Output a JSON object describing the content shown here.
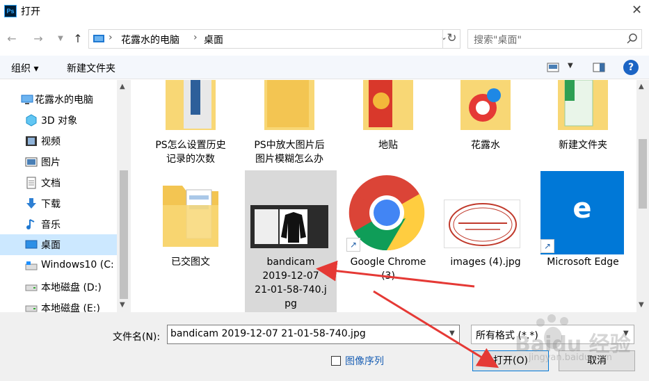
{
  "window": {
    "title": "打开",
    "app_icon": "Ps"
  },
  "address": {
    "crumbs": [
      "花露水的电脑",
      "桌面"
    ],
    "search_placeholder": "搜索\"桌面\""
  },
  "toolbar": {
    "organize": "组织 ▾",
    "new_folder": "新建文件夹",
    "help": "?"
  },
  "nav": {
    "items": [
      {
        "label": "花露水的电脑",
        "icon": "computer-icon"
      },
      {
        "label": "3D 对象",
        "icon": "cube-icon"
      },
      {
        "label": "视频",
        "icon": "video-icon"
      },
      {
        "label": "图片",
        "icon": "picture-icon"
      },
      {
        "label": "文档",
        "icon": "document-icon"
      },
      {
        "label": "下载",
        "icon": "download-icon"
      },
      {
        "label": "音乐",
        "icon": "music-icon"
      },
      {
        "label": "桌面",
        "icon": "desktop-icon"
      },
      {
        "label": "Windows10 (C:",
        "icon": "drive-icon"
      },
      {
        "label": "本地磁盘 (D:)",
        "icon": "drive-icon"
      },
      {
        "label": "本地磁盘 (E:)",
        "icon": "drive-icon"
      }
    ]
  },
  "files": {
    "row1": [
      "PS怎么设置历史\n记录的次数",
      "PS中放大图片后\n图片模糊怎么办",
      "地贴",
      "花露水",
      "新建文件夹"
    ],
    "row2": [
      "已交图文",
      "bandicam\n2019-12-07\n21-01-58-740.j\npg",
      "Google Chrome\n(3)",
      "images (4).jpg",
      "Microsoft Edge"
    ]
  },
  "bottom": {
    "filename_label": "文件名(N):",
    "filename_value": "bandicam 2019-12-07 21-01-58-740.jpg",
    "filetype": "所有格式 (*.*)",
    "sequence_label": "图像序列",
    "open_button": "打开(O)",
    "cancel_button": "取消"
  },
  "watermark": {
    "text": "Baidu 经验",
    "url": "jingyan.baidu.com"
  },
  "colors": {
    "accent": "#0078d7",
    "selection": "#cce8ff",
    "arrow": "#e53935",
    "folder": "#f8d775"
  }
}
